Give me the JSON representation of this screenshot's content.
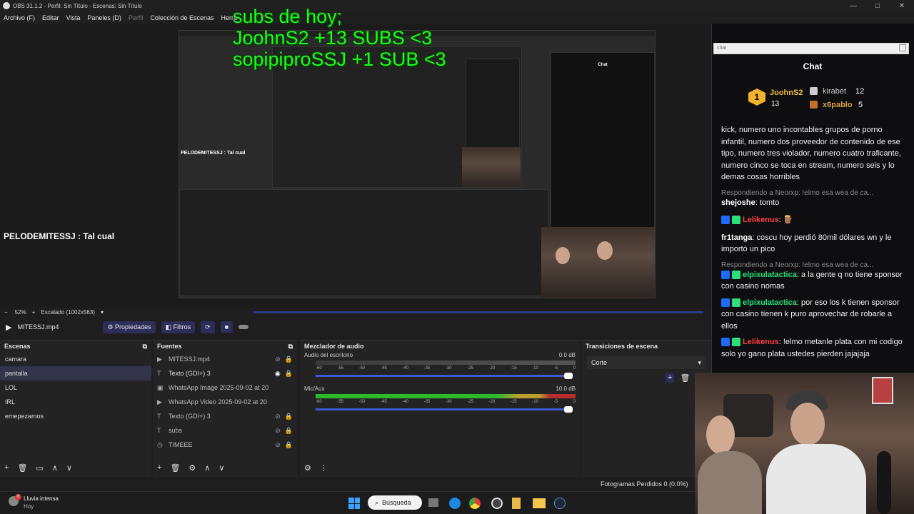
{
  "window": {
    "title": "OBS 31.1.2 - Perfil: Sin Título - Escenas: Sin Título"
  },
  "menu": {
    "items": [
      "Archivo (F)",
      "Editar",
      "Vista",
      "Paneles (D)",
      "Perfil",
      "Colección de Escenas",
      "Herra"
    ]
  },
  "overlay": {
    "line1": "subs de hoy;",
    "line2": "JoohnS2 +13 SUBS <3",
    "line3": "sopipiproSSJ +1 SUB <3"
  },
  "preview": {
    "pelo_text": "PELODEMITESSJ : Tal cual",
    "nested_pelo": "PELODEMITESSJ : Tal cual"
  },
  "zoom": {
    "level": "52%",
    "scale": "Escalado (1002x563)"
  },
  "player": {
    "file": "MITESSJ.mp4",
    "props": "Propiedades",
    "filters": "Filtros"
  },
  "scenes": {
    "title": "Escenas",
    "items": [
      "camara",
      "pantalla",
      "LOL",
      "IRL",
      "emepezamos"
    ],
    "selected": 1
  },
  "sources": {
    "title": "Fuentes",
    "items": [
      "MITESSJ.mp4",
      "Texto (GDI+) 3",
      "WhatsApp Image 2025-09-02 at 20",
      "WhatsApp Video 2025-09-02 at 20",
      "Texto (GDI+) 3",
      "subs",
      "TIMEEE"
    ]
  },
  "mixer": {
    "title": "Mezclador de audio",
    "ch1": {
      "name": "Audio del escritorio",
      "db": "0.0 dB"
    },
    "ch2": {
      "name": "Mic/Aux",
      "db": "10.0 dB"
    },
    "ticks": [
      "-60",
      "-55",
      "-50",
      "-45",
      "-40",
      "-35",
      "-30",
      "-25",
      "-20",
      "-15",
      "-10",
      "-5",
      "0"
    ]
  },
  "transitions": {
    "title": "Transiciones de escena",
    "value": "Corte"
  },
  "status": {
    "dropped": "Fotogramas Perdidos 0 (0.0%)"
  },
  "chat": {
    "search": "chat",
    "title": "Chat",
    "top": [
      {
        "name": "JoohnS2",
        "n": "13"
      },
      {
        "name": "kirabet",
        "n": "12"
      },
      {
        "name": "x6pablo",
        "n": "5"
      }
    ],
    "block1": "kick, numero uno incontables grupos de porno infantil, numero dos proveedor de contenido de ese tipo, numero tres violador, numero cuatro traficante, numero cinco se toca en stream, numero seis y lo demas cosas horribles",
    "reply1": "Respondiendo a Neorxp: !elmo esa wea de ca...",
    "user1": "shejoshe",
    "text1": "tomto",
    "user2": "Lelikenus",
    "user3": "fr1tanga",
    "text3": "coscu hoy perdió 80mil dólares wn y le importó un pico",
    "reply2": "Respondiendo a Neorxp: !elmo esa wea de ca...",
    "user4": "elpixulatactica",
    "text4": "a la gente q no tiene sponsor con casino nomas",
    "user5": "elpixulatactica",
    "text5": "por eso los k tienen sponsor con casino tienen k puro aprovechar de robarle a ellos",
    "user6": "Lelikenus",
    "text6": "!elmo metanle plata con mi codigo solo yo gano plata ustedes pierden jajajaja"
  },
  "taskbar": {
    "weather": "Lluvia intensa",
    "weather_sub": "Hoy",
    "search": "Búsqueda",
    "notif": "6"
  }
}
